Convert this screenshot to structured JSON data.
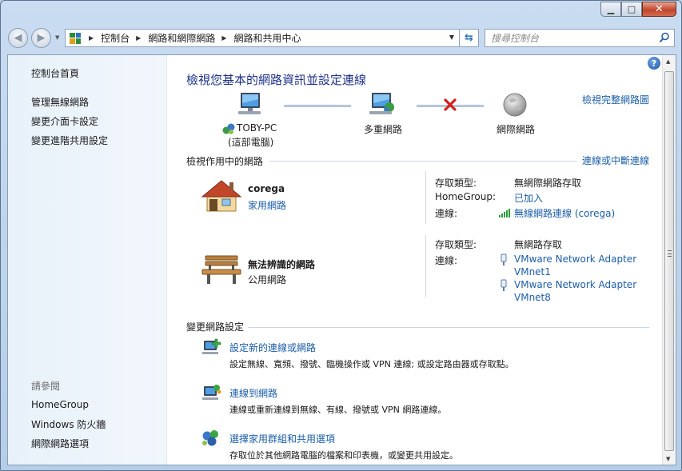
{
  "window": {
    "minimize_glyph": "▁",
    "maximize_glyph": "□",
    "close_glyph": "✕"
  },
  "nav": {
    "back_glyph": "◀",
    "forward_glyph": "▶",
    "breadcrumbs": [
      "控制台",
      "網路和網際網路",
      "網路和共用中心"
    ],
    "search_placeholder": "搜尋控制台"
  },
  "sidebar": {
    "home": "控制台首頁",
    "tasks": [
      "管理無線網路",
      "變更介面卡設定",
      "變更進階共用設定"
    ],
    "see_also_heading": "請參閱",
    "see_also": [
      "HomeGroup",
      "Windows 防火牆",
      "網際網路選項"
    ]
  },
  "main": {
    "help_glyph": "?",
    "title": "檢視您基本的網路資訊並設定連線",
    "view_full_map": "檢視完整網路圖",
    "map": {
      "computer_name": "TOBY-PC",
      "computer_sub": "(這部電腦)",
      "middle_node": "多重網路",
      "internet_node": "網際網路"
    },
    "active_networks_heading": "檢視作用中的網路",
    "connect_disconnect": "連線或中斷連線",
    "networks": [
      {
        "name": "corega",
        "type": "家用網路",
        "rows": [
          {
            "key": "存取類型:",
            "value": "無網際網路存取"
          },
          {
            "key": "HomeGroup:",
            "value": "已加入"
          },
          {
            "key": "連線:",
            "value": "無線網路連線 (corega)"
          }
        ]
      },
      {
        "name": "無法辨識的網路",
        "type": "公用網路",
        "rows": [
          {
            "key": "存取類型:",
            "value": "無網路存取"
          },
          {
            "key": "連線:",
            "value": "VMware Network Adapter",
            "value2": "VMnet1"
          },
          {
            "key": "",
            "value": "VMware Network Adapter",
            "value2": "VMnet8"
          }
        ]
      }
    ],
    "change_settings_heading": "變更網路設定",
    "tasks": [
      {
        "title": "設定新的連線或網路",
        "desc": "設定無線、寬頻、撥號、臨機操作或 VPN 連線; 或設定路由器或存取點。"
      },
      {
        "title": "連線到網路",
        "desc": "連線或重新連線到無線、有線、撥號或 VPN 網路連線。"
      },
      {
        "title": "選擇家用群組和共用選項",
        "desc": "存取位於其他網路電腦的檔案和印表機，或變更共用設定。"
      }
    ]
  }
}
